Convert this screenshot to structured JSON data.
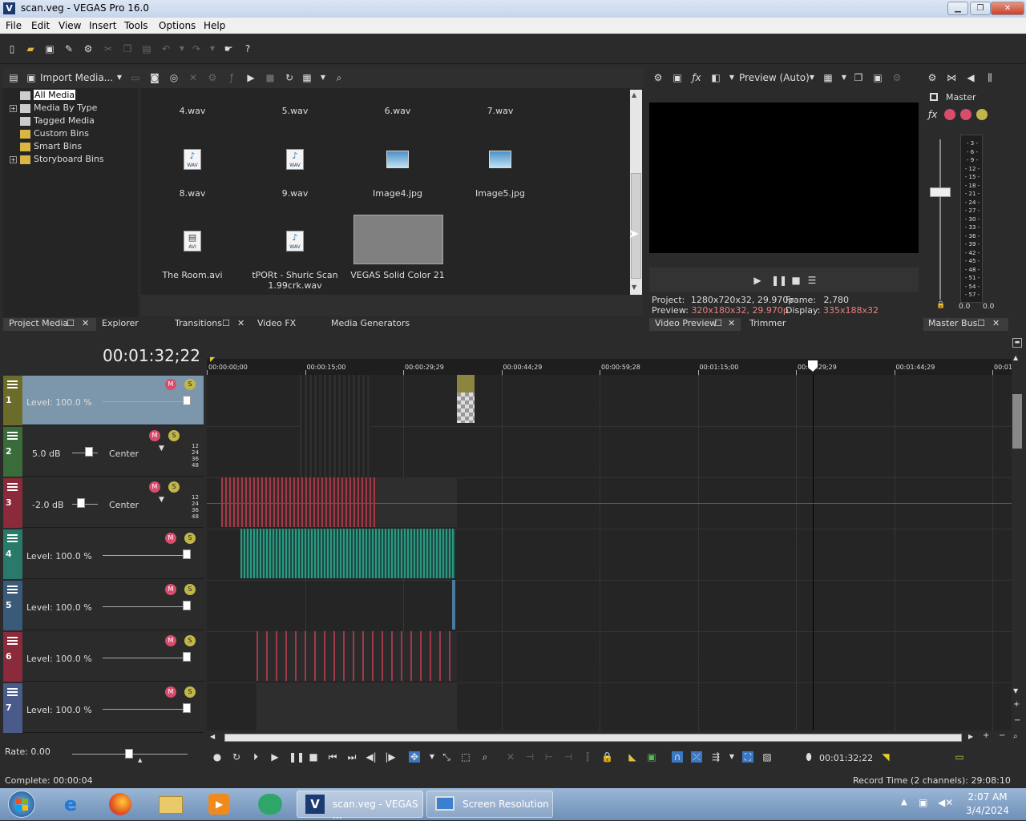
{
  "window": {
    "title": "scan.veg - VEGAS Pro 16.0",
    "logo_letter": "V"
  },
  "menu": [
    "File",
    "Edit",
    "View",
    "Insert",
    "Tools",
    "Options",
    "Help"
  ],
  "media_toolbar": {
    "import_label": "Import Media..."
  },
  "tree": [
    {
      "label": "All Media",
      "selected": true,
      "expandable": false
    },
    {
      "label": "Media By Type",
      "expandable": true
    },
    {
      "label": "Tagged Media",
      "expandable": false
    },
    {
      "label": "Custom Bins",
      "expandable": false
    },
    {
      "label": "Smart Bins",
      "expandable": false
    },
    {
      "label": "Storyboard Bins",
      "expandable": true
    }
  ],
  "media_items": [
    {
      "name": "4.wav",
      "type": "none"
    },
    {
      "name": "5.wav",
      "type": "none"
    },
    {
      "name": "6.wav",
      "type": "none"
    },
    {
      "name": "7.wav",
      "type": "none"
    },
    {
      "name": "8.wav",
      "type": "wav"
    },
    {
      "name": "9.wav",
      "type": "wav"
    },
    {
      "name": "Image4.jpg",
      "type": "img"
    },
    {
      "name": "Image5.jpg",
      "type": "img"
    },
    {
      "name": "The Room.avi",
      "type": "avi"
    },
    {
      "name": "tPORt - Shuric Scan 1.99crk.wav",
      "type": "wav"
    },
    {
      "name": "VEGAS Solid Color 21",
      "type": "solid"
    }
  ],
  "left_tabs": [
    "Project Media",
    "Explorer",
    "Transitions",
    "Video FX",
    "Media Generators"
  ],
  "preview": {
    "mode": "Preview (Auto)",
    "project_label": "Project:",
    "project_value": "1280x720x32, 29.970p",
    "frame_label": "Frame:",
    "frame_value": "2,780",
    "preview_label": "Preview:",
    "preview_value": "320x180x32, 29.970p",
    "display_label": "Display:",
    "display_value": "335x188x32"
  },
  "preview_tabs": [
    "Video Preview",
    "Trimmer"
  ],
  "master": {
    "label": "Master",
    "tab": "Master Bus",
    "scale": [
      "3",
      "6",
      "9",
      "12",
      "15",
      "18",
      "21",
      "24",
      "27",
      "30",
      "33",
      "36",
      "39",
      "42",
      "45",
      "48",
      "51",
      "54",
      "57"
    ],
    "left_value": "0.0",
    "right_value": "0.0"
  },
  "timeline": {
    "timecode": "00:01:32;22",
    "ruler": [
      "00:00:00;00",
      "00:00:15;00",
      "00:00:29;29",
      "00:00:44;29",
      "00:00:59;28",
      "00:01:15;00",
      "00:01:29;29",
      "00:01:44;29",
      "00:01:"
    ],
    "tracks": [
      {
        "num": "1",
        "kind": "video",
        "level": "Level: 100.0 %",
        "color": "#6b6b2a"
      },
      {
        "num": "2",
        "kind": "audio",
        "level": "5.0 dB",
        "pan": "Center",
        "color": "#3a6b3a"
      },
      {
        "num": "3",
        "kind": "audio",
        "level": "-2.0 dB",
        "pan": "Center",
        "color": "#8a2a3a"
      },
      {
        "num": "4",
        "kind": "video",
        "level": "Level: 100.0 %",
        "color": "#2a7a6b"
      },
      {
        "num": "5",
        "kind": "video",
        "level": "Level: 100.0 %",
        "color": "#3a5a7a"
      },
      {
        "num": "6",
        "kind": "video",
        "level": "Level: 100.0 %",
        "color": "#8a2a3a"
      },
      {
        "num": "7",
        "kind": "video",
        "level": "Level: 100.0 %",
        "color": "#4a5a8a"
      }
    ],
    "meter_scale": [
      "12",
      "24",
      "36",
      "48"
    ],
    "rate": "Rate: 0.00",
    "cursor_time": "00:01:32;22"
  },
  "status": {
    "left": "Complete: 00:00:04",
    "right": "Record Time (2 channels): 29:08:10"
  },
  "taskbar": {
    "vegas_label": "scan.veg - VEGAS ...",
    "screen_label": "Screen Resolution",
    "time": "2:07 AM",
    "date": "3/4/2024"
  }
}
